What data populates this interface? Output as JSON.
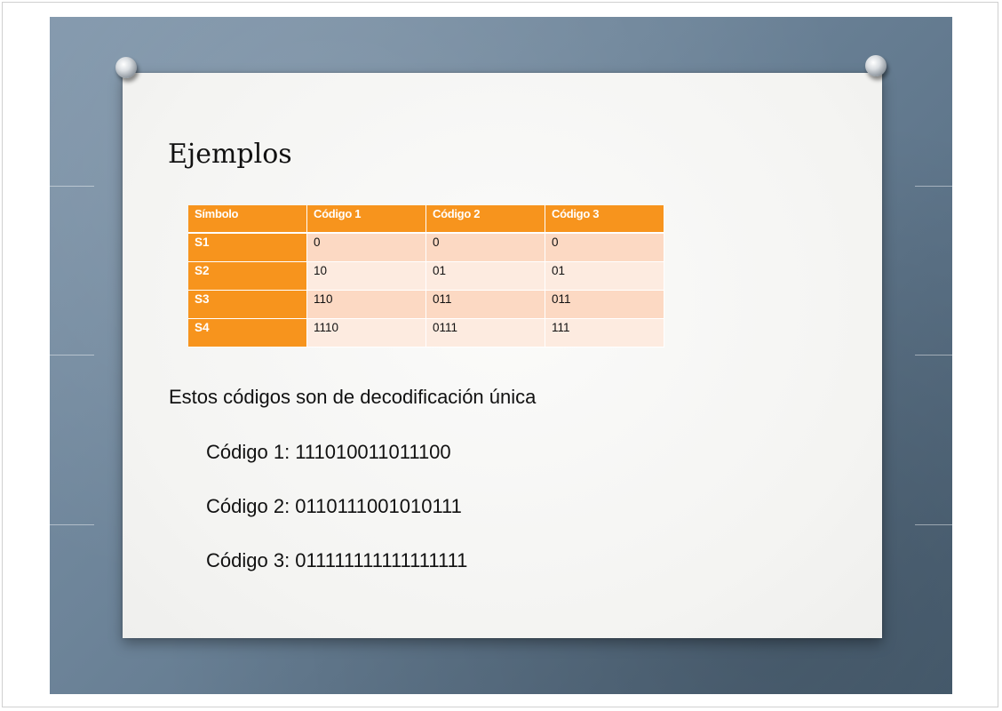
{
  "slide": {
    "title": "Ejemplos",
    "table": {
      "headers": [
        "Símbolo",
        "Código 1",
        "Código 2",
        "Código 3"
      ],
      "rows": [
        [
          "S1",
          "0",
          "0",
          "0"
        ],
        [
          "S2",
          "10",
          "01",
          "01"
        ],
        [
          "S3",
          "110",
          "011",
          "011"
        ],
        [
          "S4",
          "1110",
          "0111",
          "111"
        ]
      ]
    },
    "statement": "Estos códigos son de decodificación única",
    "examples": [
      "Código 1: 111010011011100",
      "Código 2: 0110111001010111",
      "Código 3: 011111111111111111"
    ]
  },
  "colors": {
    "header_orange": "#f7941d",
    "row_dark": "#fcd9c3",
    "row_light": "#fdebe0",
    "background_blue": "#6d8499"
  }
}
